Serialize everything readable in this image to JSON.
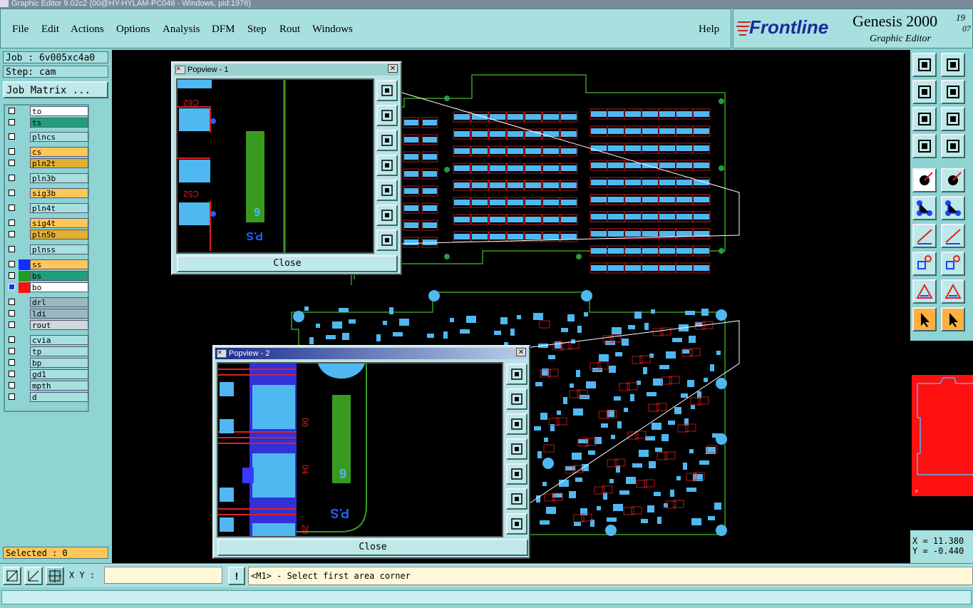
{
  "window": {
    "title": "Graphic Editor 9.02c2 (00@HY-HYLAM-PC046 - Windows, pid:1976)"
  },
  "menu": {
    "file": "File",
    "edit": "Edit",
    "actions": "Actions",
    "options": "Options",
    "analysis": "Analysis",
    "dfm": "DFM",
    "step": "Step",
    "rout": "Rout",
    "windows": "Windows",
    "help": "Help"
  },
  "brand": {
    "logo": "Frontline",
    "product": "Genesis 2000",
    "sub": "Graphic Editor",
    "version": "19",
    "version2": "07"
  },
  "job": {
    "job_label": "Job : 6v005xc4a0",
    "step_label": "Step: cam",
    "matrix_button": "Job Matrix ..."
  },
  "layers": [
    {
      "name": "to",
      "color": "#ffffff"
    },
    {
      "name": "ts",
      "color": "#1fa07a"
    },
    {
      "name": "plncs",
      "color": "#a8e0e0"
    },
    {
      "name": "cs",
      "color": "#ffc75a"
    },
    {
      "name": "pln2t",
      "color": "#e0b030"
    },
    {
      "name": "pln3b",
      "color": "#a8e0e0"
    },
    {
      "name": "sig3b",
      "color": "#ffc75a"
    },
    {
      "name": "pln4t",
      "color": "#a8e0e0"
    },
    {
      "name": "sig4t",
      "color": "#ffc75a"
    },
    {
      "name": "pln5b",
      "color": "#e0b030"
    },
    {
      "name": "plnss",
      "color": "#a8e0e0"
    },
    {
      "name": "ss",
      "color": "#ffc75a"
    },
    {
      "name": "bs",
      "color": "#1fa07a"
    },
    {
      "name": "bo",
      "color": "#ffffff"
    },
    {
      "name": "drl",
      "color": "#9ab8c0"
    },
    {
      "name": "ldi",
      "color": "#9ab8c0"
    },
    {
      "name": "rout",
      "color": "#d0d8d8"
    },
    {
      "name": "cvia",
      "color": "#a8e0e0"
    },
    {
      "name": "tp",
      "color": "#a8e0e0"
    },
    {
      "name": "bp",
      "color": "#a8e0e0"
    },
    {
      "name": "gd1",
      "color": "#a8e0e0"
    },
    {
      "name": "mpth",
      "color": "#a8e0e0"
    },
    {
      "name": "d",
      "color": "#a8e0e0"
    }
  ],
  "selected": "Selected : 0",
  "popviews": [
    {
      "title": "Popview - 1",
      "close_label": "Close",
      "texts": [
        "C62",
        "C52",
        "6",
        "P.S"
      ]
    },
    {
      "title": "Popview - 2",
      "close_label": "Close",
      "texts": [
        "06",
        "04",
        "6",
        "P.S",
        "20"
      ]
    }
  ],
  "coords": {
    "x": "X = 11.380",
    "y": "Y = -0.440"
  },
  "status": {
    "xy_label": "X Y :",
    "xy_value": "",
    "message": "<M1> - Select first area corner"
  },
  "colors": {
    "panel": "#8fd3d3",
    "pad": "#4fb8f0",
    "trace": "#e02020",
    "via": "#2a9a3a",
    "background": "#000000"
  }
}
